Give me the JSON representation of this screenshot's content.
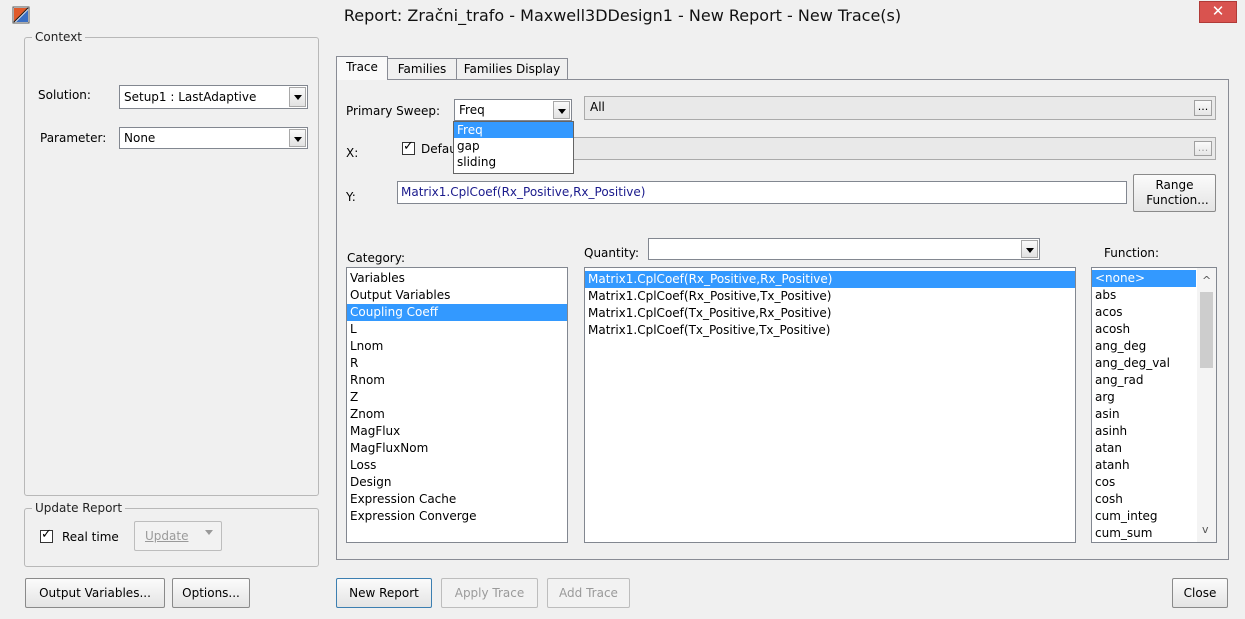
{
  "window": {
    "title": "Report: Zračni_trafo - Maxwell3DDesign1 - New Report - New Trace(s)",
    "close_glyph": "✕"
  },
  "context": {
    "legend": "Context",
    "solution_label": "Solution:",
    "solution_value": "Setup1 : LastAdaptive",
    "parameter_label": "Parameter:",
    "parameter_value": "None"
  },
  "update_report": {
    "legend": "Update Report",
    "realtime_label": "Real time",
    "realtime_checked": true,
    "update_label": "Update"
  },
  "tabs": [
    {
      "label": "Trace",
      "active": true
    },
    {
      "label": "Families",
      "active": false
    },
    {
      "label": "Families Display",
      "active": false
    }
  ],
  "trace": {
    "primary_sweep_label": "Primary Sweep:",
    "primary_sweep_value": "Freq",
    "sweep_range_value": "All",
    "sweep_options": [
      "Freq",
      "gap",
      "sliding"
    ],
    "sweep_selected_index": 0,
    "x_label": "X:",
    "x_default_label": "Default",
    "x_default_checked": true,
    "y_label": "Y:",
    "y_value": "Matrix1.CplCoef(Rx_Positive,Rx_Positive)",
    "range_function_label_1": "Range",
    "range_function_label_2": "Function...",
    "ellipsis": "..."
  },
  "category": {
    "label": "Category:",
    "items": [
      "Variables",
      "Output Variables",
      "Coupling Coeff",
      "L",
      "Lnom",
      "R",
      "Rnom",
      "Z",
      "Znom",
      "MagFlux",
      "MagFluxNom",
      "Loss",
      "Design",
      "Expression Cache",
      "Expression Converge"
    ],
    "selected_index": 2
  },
  "quantity": {
    "label": "Quantity:",
    "filter_value": "",
    "items": [
      "Matrix1.CplCoef(Rx_Positive,Rx_Positive)",
      "Matrix1.CplCoef(Rx_Positive,Tx_Positive)",
      "Matrix1.CplCoef(Tx_Positive,Rx_Positive)",
      "Matrix1.CplCoef(Tx_Positive,Tx_Positive)"
    ],
    "selected_index": 0
  },
  "function": {
    "label": "Function:",
    "items": [
      "<none>",
      "abs",
      "acos",
      "acosh",
      "ang_deg",
      "ang_deg_val",
      "ang_rad",
      "arg",
      "asin",
      "asinh",
      "atan",
      "atanh",
      "cos",
      "cosh",
      "cum_integ",
      "cum_sum"
    ],
    "selected_index": 0
  },
  "buttons": {
    "output_variables": "Output Variables...",
    "options": "Options...",
    "new_report": "New Report",
    "apply_trace": "Apply Trace",
    "add_trace": "Add Trace",
    "close": "Close"
  },
  "colors": {
    "selection": "#3399ff",
    "close_button": "#d9534f",
    "y_text": "#1a1a8c"
  }
}
